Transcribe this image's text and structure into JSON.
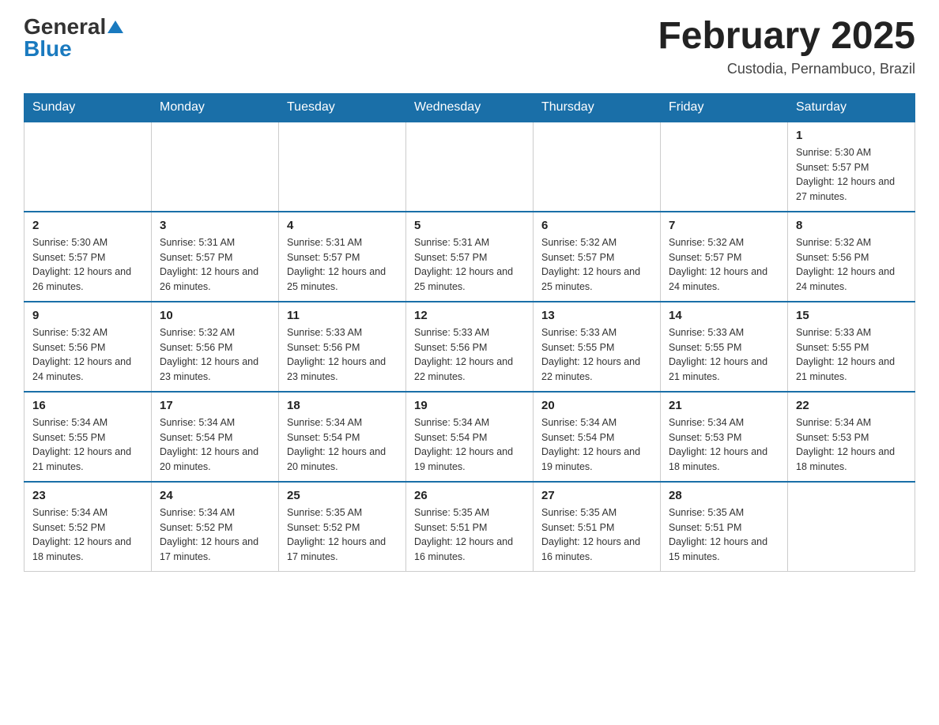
{
  "logo": {
    "general": "General",
    "blue": "Blue"
  },
  "title": "February 2025",
  "location": "Custodia, Pernambuco, Brazil",
  "days_of_week": [
    "Sunday",
    "Monday",
    "Tuesday",
    "Wednesday",
    "Thursday",
    "Friday",
    "Saturday"
  ],
  "weeks": [
    [
      {
        "day": "",
        "info": ""
      },
      {
        "day": "",
        "info": ""
      },
      {
        "day": "",
        "info": ""
      },
      {
        "day": "",
        "info": ""
      },
      {
        "day": "",
        "info": ""
      },
      {
        "day": "",
        "info": ""
      },
      {
        "day": "1",
        "info": "Sunrise: 5:30 AM\nSunset: 5:57 PM\nDaylight: 12 hours and 27 minutes."
      }
    ],
    [
      {
        "day": "2",
        "info": "Sunrise: 5:30 AM\nSunset: 5:57 PM\nDaylight: 12 hours and 26 minutes."
      },
      {
        "day": "3",
        "info": "Sunrise: 5:31 AM\nSunset: 5:57 PM\nDaylight: 12 hours and 26 minutes."
      },
      {
        "day": "4",
        "info": "Sunrise: 5:31 AM\nSunset: 5:57 PM\nDaylight: 12 hours and 25 minutes."
      },
      {
        "day": "5",
        "info": "Sunrise: 5:31 AM\nSunset: 5:57 PM\nDaylight: 12 hours and 25 minutes."
      },
      {
        "day": "6",
        "info": "Sunrise: 5:32 AM\nSunset: 5:57 PM\nDaylight: 12 hours and 25 minutes."
      },
      {
        "day": "7",
        "info": "Sunrise: 5:32 AM\nSunset: 5:57 PM\nDaylight: 12 hours and 24 minutes."
      },
      {
        "day": "8",
        "info": "Sunrise: 5:32 AM\nSunset: 5:56 PM\nDaylight: 12 hours and 24 minutes."
      }
    ],
    [
      {
        "day": "9",
        "info": "Sunrise: 5:32 AM\nSunset: 5:56 PM\nDaylight: 12 hours and 24 minutes."
      },
      {
        "day": "10",
        "info": "Sunrise: 5:32 AM\nSunset: 5:56 PM\nDaylight: 12 hours and 23 minutes."
      },
      {
        "day": "11",
        "info": "Sunrise: 5:33 AM\nSunset: 5:56 PM\nDaylight: 12 hours and 23 minutes."
      },
      {
        "day": "12",
        "info": "Sunrise: 5:33 AM\nSunset: 5:56 PM\nDaylight: 12 hours and 22 minutes."
      },
      {
        "day": "13",
        "info": "Sunrise: 5:33 AM\nSunset: 5:55 PM\nDaylight: 12 hours and 22 minutes."
      },
      {
        "day": "14",
        "info": "Sunrise: 5:33 AM\nSunset: 5:55 PM\nDaylight: 12 hours and 21 minutes."
      },
      {
        "day": "15",
        "info": "Sunrise: 5:33 AM\nSunset: 5:55 PM\nDaylight: 12 hours and 21 minutes."
      }
    ],
    [
      {
        "day": "16",
        "info": "Sunrise: 5:34 AM\nSunset: 5:55 PM\nDaylight: 12 hours and 21 minutes."
      },
      {
        "day": "17",
        "info": "Sunrise: 5:34 AM\nSunset: 5:54 PM\nDaylight: 12 hours and 20 minutes."
      },
      {
        "day": "18",
        "info": "Sunrise: 5:34 AM\nSunset: 5:54 PM\nDaylight: 12 hours and 20 minutes."
      },
      {
        "day": "19",
        "info": "Sunrise: 5:34 AM\nSunset: 5:54 PM\nDaylight: 12 hours and 19 minutes."
      },
      {
        "day": "20",
        "info": "Sunrise: 5:34 AM\nSunset: 5:54 PM\nDaylight: 12 hours and 19 minutes."
      },
      {
        "day": "21",
        "info": "Sunrise: 5:34 AM\nSunset: 5:53 PM\nDaylight: 12 hours and 18 minutes."
      },
      {
        "day": "22",
        "info": "Sunrise: 5:34 AM\nSunset: 5:53 PM\nDaylight: 12 hours and 18 minutes."
      }
    ],
    [
      {
        "day": "23",
        "info": "Sunrise: 5:34 AM\nSunset: 5:52 PM\nDaylight: 12 hours and 18 minutes."
      },
      {
        "day": "24",
        "info": "Sunrise: 5:34 AM\nSunset: 5:52 PM\nDaylight: 12 hours and 17 minutes."
      },
      {
        "day": "25",
        "info": "Sunrise: 5:35 AM\nSunset: 5:52 PM\nDaylight: 12 hours and 17 minutes."
      },
      {
        "day": "26",
        "info": "Sunrise: 5:35 AM\nSunset: 5:51 PM\nDaylight: 12 hours and 16 minutes."
      },
      {
        "day": "27",
        "info": "Sunrise: 5:35 AM\nSunset: 5:51 PM\nDaylight: 12 hours and 16 minutes."
      },
      {
        "day": "28",
        "info": "Sunrise: 5:35 AM\nSunset: 5:51 PM\nDaylight: 12 hours and 15 minutes."
      },
      {
        "day": "",
        "info": ""
      }
    ]
  ]
}
